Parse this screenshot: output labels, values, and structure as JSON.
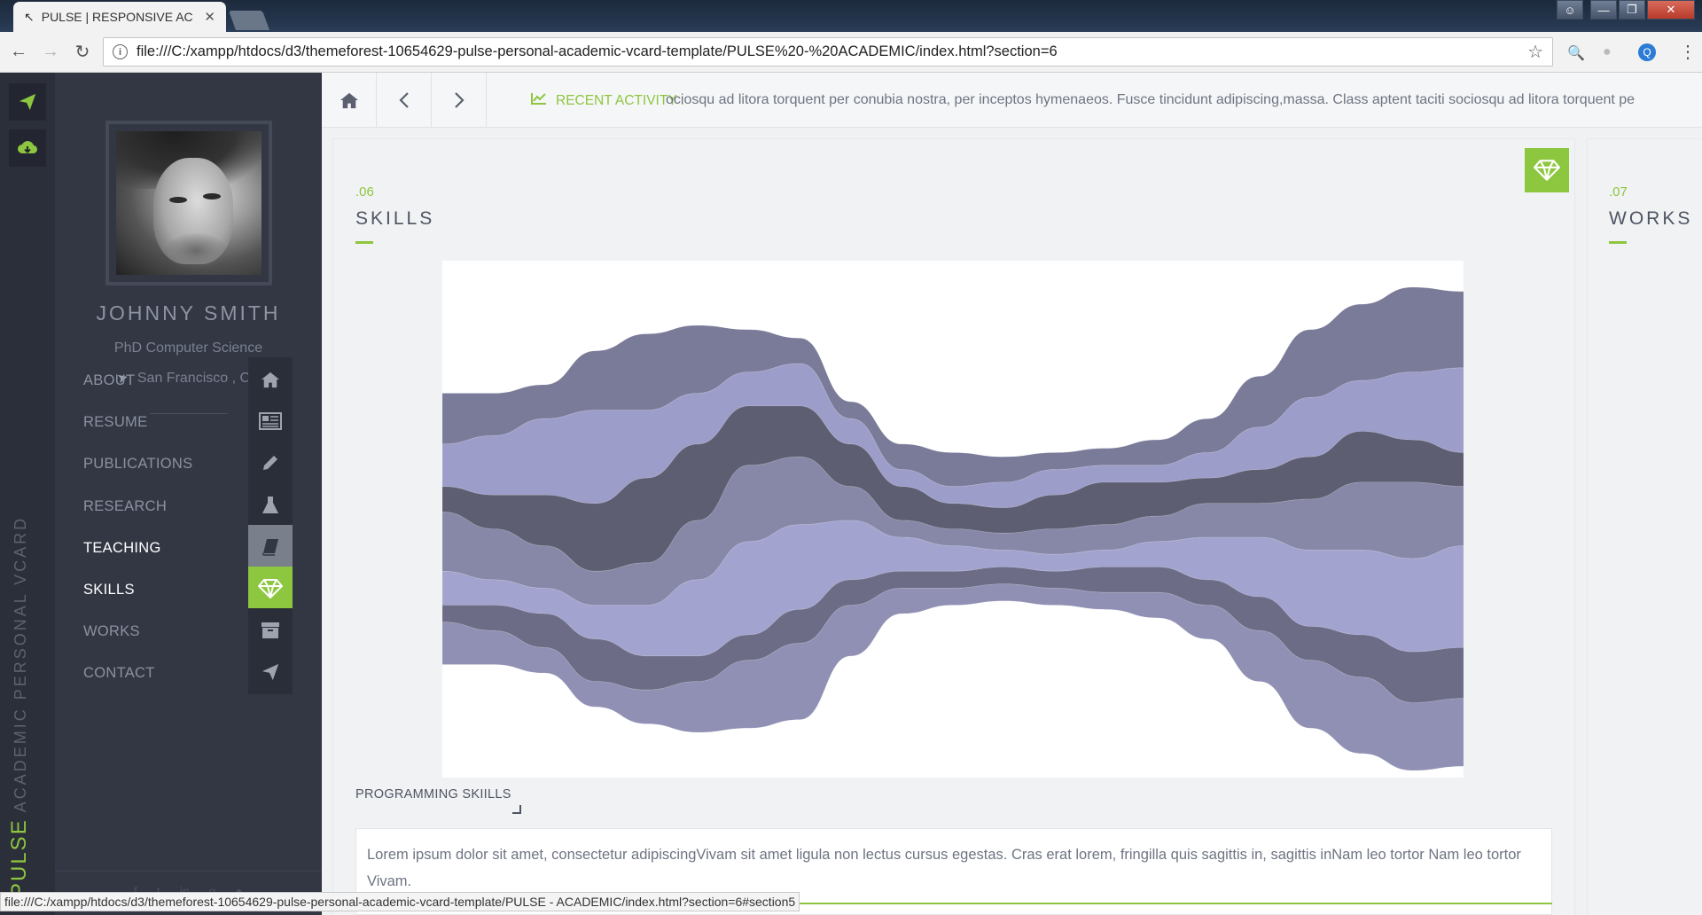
{
  "browser": {
    "tab_title": "PULSE | RESPONSIVE AC",
    "url": "file:///C:/xampp/htdocs/d3/themeforest-10654629-pulse-personal-academic-vcard-template/PULSE%20-%20ACADEMIC/index.html?section=6",
    "status_url": "file:///C:/xampp/htdocs/d3/themeforest-10654629-pulse-personal-academic-vcard-template/PULSE - ACADEMIC/index.html?section=6#section5"
  },
  "rail": {
    "brand": "PULSE",
    "subtitle": "ACADEMIC PERSONAL VCARD"
  },
  "profile": {
    "name": "JOHNNY SMITH",
    "title": "PhD Computer Science",
    "location": "San Francisco , CA"
  },
  "menu": [
    {
      "label": "ABOUT",
      "icon": "home-icon"
    },
    {
      "label": "RESUME",
      "icon": "newspaper-icon"
    },
    {
      "label": "PUBLICATIONS",
      "icon": "pencil-icon"
    },
    {
      "label": "RESEARCH",
      "icon": "flask-icon"
    },
    {
      "label": "TEACHING",
      "icon": "book-icon"
    },
    {
      "label": "SKILLS",
      "icon": "diamond-icon"
    },
    {
      "label": "WORKS",
      "icon": "archive-icon"
    },
    {
      "label": "CONTACT",
      "icon": "paper-plane-icon"
    }
  ],
  "topbar": {
    "activity_label": "RECENT ACTIVITY :",
    "activity_text": "ociosqu ad litora torquent per conubia nostra, per inceptos hymenaeos. Fusce tincidunt adipiscing,massa. Class aptent taciti sociosqu ad litora torquent pe"
  },
  "section": {
    "number": ".06",
    "title": "SKILLS",
    "chart_caption": "PROGRAMMING SKIILLS",
    "description": "Lorem ipsum dolor sit amet, consectetur adipiscingVivam sit amet ligula non lectus cursus egestas. Cras erat lorem, fringilla quis sagittis in, sagittis inNam leo tortor Nam leo tortor Vivam."
  },
  "next_section": {
    "number": ".07",
    "title": "WORKS"
  },
  "colors": {
    "accent": "#8dc63f",
    "sidebar": "#333744",
    "rail": "#2b2f39"
  },
  "chart_data": {
    "type": "area",
    "stacked": true,
    "offset": "silhouette",
    "interpolation": "basis",
    "x": [
      0,
      1,
      2,
      3,
      4,
      5,
      6,
      7,
      8,
      9,
      10,
      11,
      12,
      13,
      14,
      15,
      16,
      17,
      18,
      19,
      20
    ],
    "series": [
      {
        "color": "#7a7a99",
        "values": [
          6,
          5,
          4,
          7,
          9,
          8,
          5,
          3,
          2,
          3,
          4,
          3,
          2,
          2,
          3,
          4,
          6,
          8,
          9,
          10,
          9
        ]
      },
      {
        "color": "#9d9dca",
        "values": [
          5,
          7,
          9,
          11,
          8,
          6,
          4,
          5,
          3,
          2,
          2,
          3,
          3,
          2,
          2,
          3,
          5,
          7,
          6,
          8,
          10
        ]
      },
      {
        "color": "#5e5e72",
        "values": [
          3,
          4,
          6,
          8,
          10,
          9,
          7,
          6,
          5,
          4,
          3,
          3,
          4,
          5,
          4,
          3,
          4,
          5,
          6,
          5,
          4
        ]
      },
      {
        "color": "#8787a8",
        "values": [
          7,
          6,
          5,
          4,
          5,
          7,
          9,
          8,
          4,
          2,
          2,
          2,
          3,
          3,
          3,
          4,
          4,
          6,
          8,
          9,
          7
        ]
      },
      {
        "color": "#a3a3d0",
        "values": [
          4,
          3,
          3,
          4,
          6,
          9,
          11,
          10,
          7,
          4,
          3,
          2,
          2,
          2,
          3,
          5,
          7,
          9,
          10,
          11,
          12
        ]
      },
      {
        "color": "#6c6c86",
        "values": [
          2,
          3,
          4,
          5,
          4,
          3,
          3,
          4,
          3,
          2,
          2,
          2,
          2,
          3,
          3,
          3,
          4,
          4,
          5,
          6,
          6
        ]
      },
      {
        "color": "#9090b4",
        "values": [
          5,
          4,
          3,
          3,
          4,
          6,
          8,
          9,
          6,
          3,
          2,
          2,
          2,
          2,
          3,
          4,
          6,
          8,
          9,
          8,
          8
        ]
      }
    ]
  }
}
